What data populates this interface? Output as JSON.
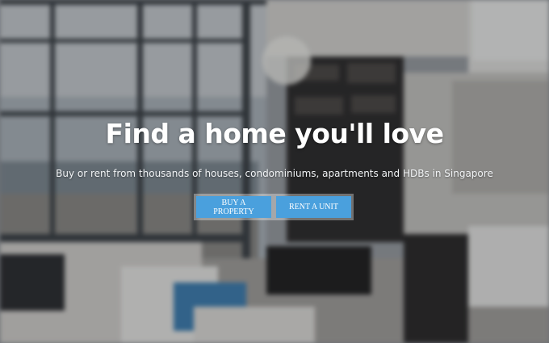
{
  "hero": {
    "title": "Find a home you'll love",
    "subtitle": "Buy or rent from thousands of houses, condominiums, apartments and HDBs in Singapore",
    "buy_label": "BUY A PROPERTY",
    "rent_label": "RENT A UNIT"
  },
  "colors": {
    "button": "#4aa0dd",
    "text": "#ffffff"
  }
}
